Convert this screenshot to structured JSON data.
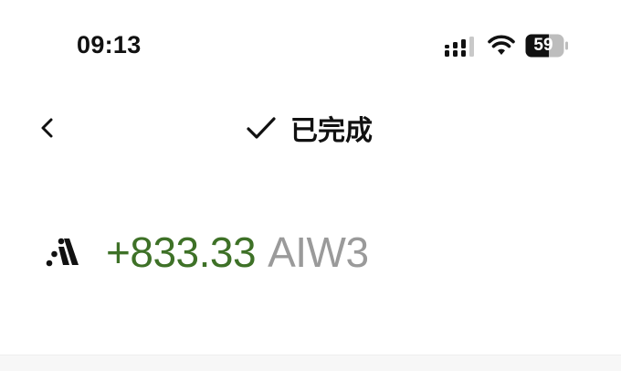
{
  "status_bar": {
    "time": "09:13",
    "battery_level": "59",
    "signal_icon": "cellular-signal-icon",
    "wifi_icon": "wifi-icon",
    "battery_icon": "battery-icon"
  },
  "nav": {
    "back_icon": "chevron-left-icon",
    "status_icon": "checkmark-icon",
    "title": "已完成"
  },
  "transaction": {
    "token_icon": "token-logo-icon",
    "amount": "+833.33",
    "symbol": "AIW3",
    "amount_color": "#3e7127",
    "symbol_color": "#9a9a9a"
  }
}
